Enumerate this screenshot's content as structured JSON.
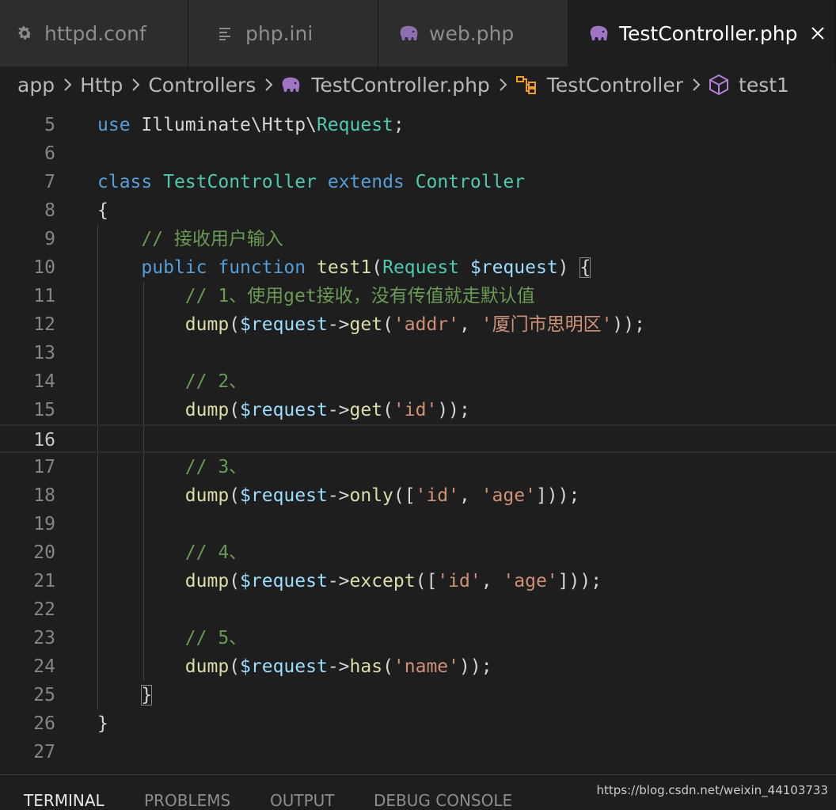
{
  "tabs": [
    {
      "label": "httpd.conf",
      "icon": "gear-icon",
      "active": false
    },
    {
      "label": "php.ini",
      "icon": "list-icon",
      "active": false
    },
    {
      "label": "web.php",
      "icon": "php-elephant-icon",
      "active": false
    },
    {
      "label": "TestController.php",
      "icon": "php-elephant-icon",
      "active": true
    }
  ],
  "breadcrumb": [
    "app",
    "Http",
    "Controllers",
    "TestController.php",
    "TestController",
    "test1"
  ],
  "current_line": 16,
  "code": [
    {
      "n": "5",
      "tokens": [
        [
          "kw",
          "use"
        ],
        [
          "plain",
          " Illuminate\\Http\\"
        ],
        [
          "type",
          "Request"
        ],
        [
          "plain",
          ";"
        ]
      ]
    },
    {
      "n": "6",
      "tokens": []
    },
    {
      "n": "7",
      "tokens": [
        [
          "kw",
          "class"
        ],
        [
          "plain",
          " "
        ],
        [
          "type",
          "TestController"
        ],
        [
          "plain",
          " "
        ],
        [
          "kw",
          "extends"
        ],
        [
          "plain",
          " "
        ],
        [
          "type",
          "Controller"
        ]
      ]
    },
    {
      "n": "8",
      "tokens": [
        [
          "plain",
          "{"
        ]
      ]
    },
    {
      "n": "9",
      "tokens": [
        [
          "plain",
          "    "
        ],
        [
          "cmt",
          "// 接收用户输入"
        ]
      ]
    },
    {
      "n": "10",
      "tokens": [
        [
          "plain",
          "    "
        ],
        [
          "kw",
          "public"
        ],
        [
          "plain",
          " "
        ],
        [
          "kw",
          "function"
        ],
        [
          "plain",
          " "
        ],
        [
          "fn",
          "test1"
        ],
        [
          "plain",
          "("
        ],
        [
          "type",
          "Request"
        ],
        [
          "plain",
          " "
        ],
        [
          "var",
          "$request"
        ],
        [
          "plain",
          ") "
        ],
        [
          "plain",
          "{"
        ]
      ]
    },
    {
      "n": "11",
      "tokens": [
        [
          "plain",
          "        "
        ],
        [
          "cmt",
          "// 1、使用get接收，没有传值就走默认值"
        ]
      ]
    },
    {
      "n": "12",
      "tokens": [
        [
          "plain",
          "        "
        ],
        [
          "fn",
          "dump"
        ],
        [
          "plain",
          "("
        ],
        [
          "var",
          "$request"
        ],
        [
          "plain",
          "->"
        ],
        [
          "fn",
          "get"
        ],
        [
          "plain",
          "("
        ],
        [
          "str",
          "'addr'"
        ],
        [
          "plain",
          ", "
        ],
        [
          "str",
          "'厦门市思明区'"
        ],
        [
          "plain",
          "));"
        ]
      ]
    },
    {
      "n": "13",
      "tokens": []
    },
    {
      "n": "14",
      "tokens": [
        [
          "plain",
          "        "
        ],
        [
          "cmt",
          "// 2、"
        ]
      ]
    },
    {
      "n": "15",
      "tokens": [
        [
          "plain",
          "        "
        ],
        [
          "fn",
          "dump"
        ],
        [
          "plain",
          "("
        ],
        [
          "var",
          "$request"
        ],
        [
          "plain",
          "->"
        ],
        [
          "fn",
          "get"
        ],
        [
          "plain",
          "("
        ],
        [
          "str",
          "'id'"
        ],
        [
          "plain",
          "));"
        ]
      ]
    },
    {
      "n": "16",
      "tokens": []
    },
    {
      "n": "17",
      "tokens": [
        [
          "plain",
          "        "
        ],
        [
          "cmt",
          "// 3、"
        ]
      ]
    },
    {
      "n": "18",
      "tokens": [
        [
          "plain",
          "        "
        ],
        [
          "fn",
          "dump"
        ],
        [
          "plain",
          "("
        ],
        [
          "var",
          "$request"
        ],
        [
          "plain",
          "->"
        ],
        [
          "fn",
          "only"
        ],
        [
          "plain",
          "(["
        ],
        [
          "str",
          "'id'"
        ],
        [
          "plain",
          ", "
        ],
        [
          "str",
          "'age'"
        ],
        [
          "plain",
          "]));"
        ]
      ]
    },
    {
      "n": "19",
      "tokens": []
    },
    {
      "n": "20",
      "tokens": [
        [
          "plain",
          "        "
        ],
        [
          "cmt",
          "// 4、"
        ]
      ]
    },
    {
      "n": "21",
      "tokens": [
        [
          "plain",
          "        "
        ],
        [
          "fn",
          "dump"
        ],
        [
          "plain",
          "("
        ],
        [
          "var",
          "$request"
        ],
        [
          "plain",
          "->"
        ],
        [
          "fn",
          "except"
        ],
        [
          "plain",
          "(["
        ],
        [
          "str",
          "'id'"
        ],
        [
          "plain",
          ", "
        ],
        [
          "str",
          "'age'"
        ],
        [
          "plain",
          "]));"
        ]
      ]
    },
    {
      "n": "22",
      "tokens": []
    },
    {
      "n": "23",
      "tokens": [
        [
          "plain",
          "        "
        ],
        [
          "cmt",
          "// 5、"
        ]
      ]
    },
    {
      "n": "24",
      "tokens": [
        [
          "plain",
          "        "
        ],
        [
          "fn",
          "dump"
        ],
        [
          "plain",
          "("
        ],
        [
          "var",
          "$request"
        ],
        [
          "plain",
          "->"
        ],
        [
          "fn",
          "has"
        ],
        [
          "plain",
          "("
        ],
        [
          "str",
          "'name'"
        ],
        [
          "plain",
          "));"
        ]
      ]
    },
    {
      "n": "25",
      "tokens": [
        [
          "plain",
          "    "
        ],
        [
          "plain",
          "}"
        ]
      ]
    },
    {
      "n": "26",
      "tokens": [
        [
          "plain",
          "}"
        ]
      ]
    },
    {
      "n": "27",
      "tokens": []
    }
  ],
  "panel_tabs": [
    "TERMINAL",
    "PROBLEMS",
    "OUTPUT",
    "DEBUG CONSOLE"
  ],
  "watermark": "https://blog.csdn.net/weixin_44103733",
  "colors": {
    "keyword": "#569cd6",
    "type": "#4ec9b0",
    "function": "#dcdcaa",
    "variable": "#9cdcfe",
    "string": "#ce9178",
    "comment": "#6a9955",
    "php_icon": "#a074c4",
    "class_icon": "#ee9d28",
    "method_icon": "#b180d7"
  }
}
